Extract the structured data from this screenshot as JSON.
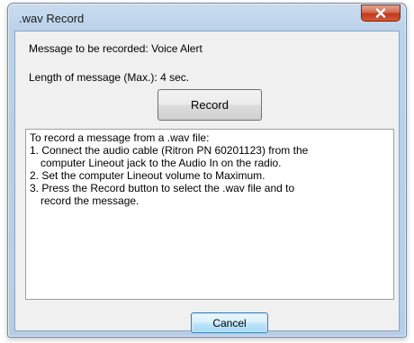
{
  "window": {
    "title": ".wav Record",
    "close_icon": "close-x-icon"
  },
  "labels": {
    "message": "Message to be recorded: Voice Alert",
    "length": "Length of message (Max.): 4 sec."
  },
  "buttons": {
    "record": "Record",
    "cancel": "Cancel"
  },
  "instructions": {
    "lines": [
      "To record a message from a .wav file:",
      "1. Connect the audio cable (Ritron PN 60201123) from the",
      "computer Lineout  jack to the Audio In on the radio.",
      "2. Set the computer Lineout volume to Maximum.",
      "3. Press the Record button to select the .wav file and to",
      "record the message."
    ]
  },
  "colors": {
    "titlebar": "#bcd2ea",
    "close_button": "#c2391b",
    "dialog_background": "#f0f0f0",
    "cancel_button_focus": "#3c7fb1"
  }
}
